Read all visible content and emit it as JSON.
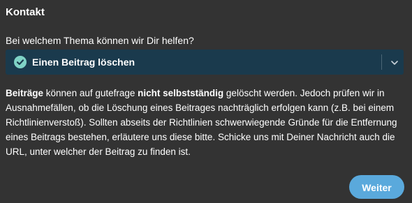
{
  "header": {
    "title": "Kontakt"
  },
  "form": {
    "question": "Bei welchem Thema können wir Dir helfen?",
    "topic_select": {
      "selected_value": "Einen Beitrag löschen",
      "status_icon": "check-circle-icon",
      "dropdown_icon": "chevron-down-icon"
    },
    "description": {
      "part1_bold": "Beiträge",
      "part2": " können auf gutefrage ",
      "part3_bold": "nicht selbstständig",
      "part4": " gelöscht werden. Jedoch prüfen wir in Ausnahmefällen, ob die Löschung eines Beitrages nachträglich erfolgen kann (z.B. bei einem Richtlinienverstoß). Sollten abseits der Richtlinien schwerwiegende Gründe für die Entfernung eines Beitrags bestehen, erläutere uns diese bitte. Schicke uns mit Deiner Nachricht auch die URL, unter welcher der Beitrag zu finden ist."
    },
    "submit_label": "Weiter"
  },
  "colors": {
    "background": "#333333",
    "select_background": "#1a3a4d",
    "check_accent": "#7fd3c6",
    "button_accent": "#5aa9dc"
  }
}
